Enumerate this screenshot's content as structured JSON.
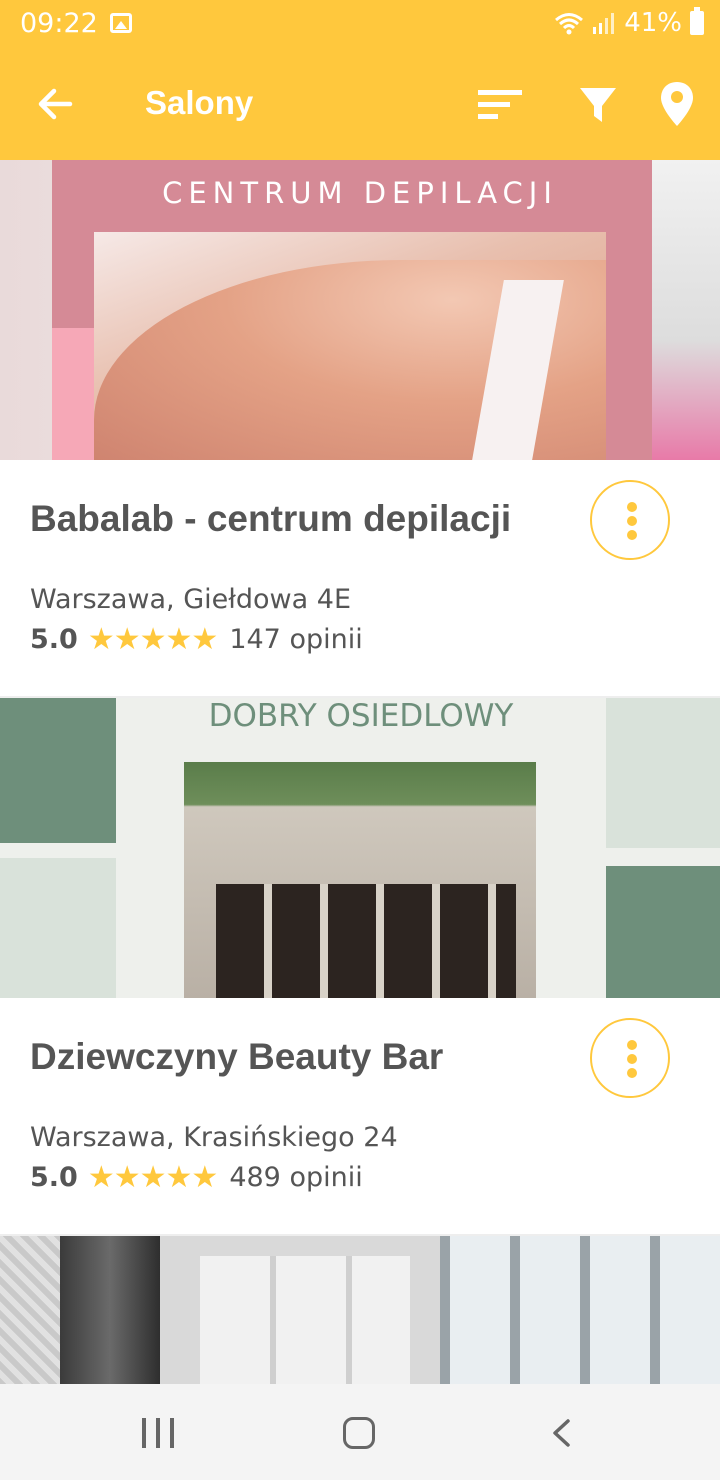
{
  "status_bar": {
    "time": "09:22",
    "battery": "41%",
    "icons": [
      "gallery-icon",
      "wifi-icon",
      "signal-icon",
      "battery-icon"
    ]
  },
  "app_bar": {
    "title": "Salony",
    "icons": [
      "back-arrow-icon",
      "sort-icon",
      "filter-icon",
      "location-pin-icon"
    ],
    "color": "#ffc83d"
  },
  "salons": [
    {
      "name": "Babalab - centrum depilacji",
      "address": "Warszawa, Giełdowa 4E",
      "rating": "5.0",
      "stars": "★★★★★",
      "reviews": "147 opinii",
      "image_text": "CENTRUM DEPILACJI"
    },
    {
      "name": "Dziewczyny Beauty Bar",
      "address": "Warszawa, Krasińskiego 24",
      "rating": "5.0",
      "stars": "★★★★★",
      "reviews": "489 opinii",
      "image_text": "DOBRY OSIEDLOWY"
    }
  ],
  "colors": {
    "accent": "#ffc83d",
    "text": "#555555"
  },
  "nav_bar": {
    "icons": [
      "recent-apps-icon",
      "home-icon",
      "back-icon"
    ]
  }
}
